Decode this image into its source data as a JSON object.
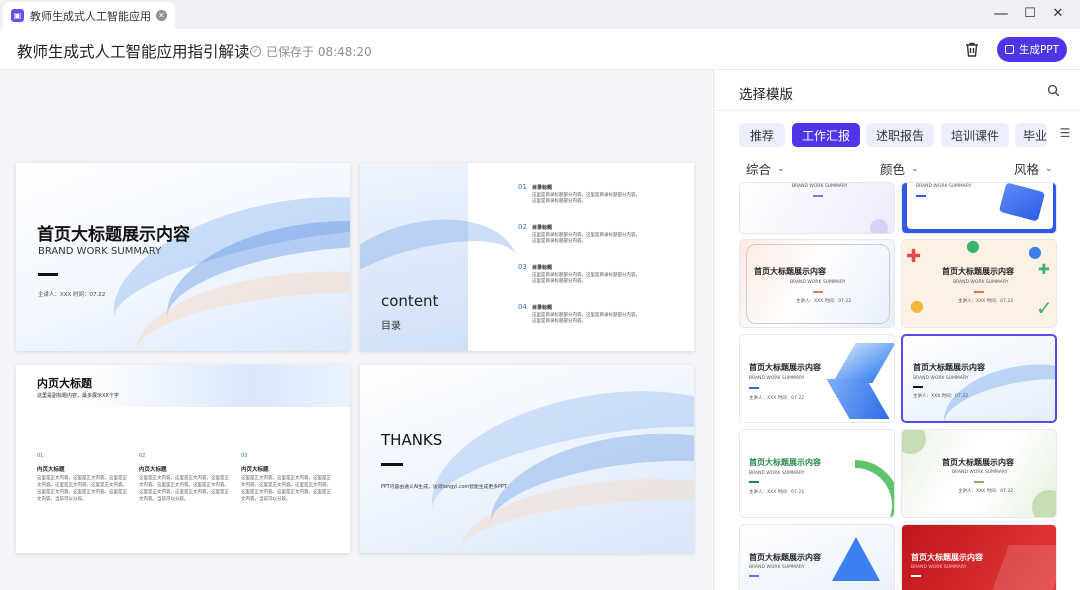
{
  "window": {
    "tab_icon": "ppt-icon",
    "tab_title": "教师生成式人工智能应用指...",
    "controls": [
      "☰",
      "—",
      "☐",
      "✕"
    ]
  },
  "header": {
    "doc_title": "教师生成式人工智能应用指引解读",
    "saved_text": "已保存于 08:48:20",
    "generate_label": "生成PPT",
    "accent": "#4f35e8"
  },
  "slides": {
    "cover": {
      "title": "首页大标题展示内容",
      "subtitle": "BRAND WORK SUMMARY",
      "meta": "主讲人：XXX  时间：07.22"
    },
    "toc": {
      "title": "content",
      "subtitle": "目录",
      "items": [
        {
          "num": "01",
          "head": "目录标题",
          "text": "这里是目录标题部分内容。这里是目录标题部分内容。这里是目录标题部分内容。"
        },
        {
          "num": "02",
          "head": "目录标题",
          "text": "这里是目录标题部分内容。这里是目录标题部分内容。这里是目录标题部分内容。"
        },
        {
          "num": "03",
          "head": "目录标题",
          "text": "这里是目录标题部分内容。这里是目录标题部分内容。这里是目录标题部分内容。"
        },
        {
          "num": "04",
          "head": "目录标题",
          "text": "这里是目录标题部分内容。这里是目录标题部分内容。这里是目录标题部分内容。"
        }
      ]
    },
    "inner": {
      "title": "内页大标题",
      "subtitle": "这里是副标题内容，最多展示XX个字",
      "cols": [
        {
          "num": "01",
          "head": "内页大标题",
          "text": "这里是正文内容。这里是正文内容。这里是正文内容。这里是正文内容。这里是正文内容。这里是正文内容。这里是正文内容。这里是正文内容。当前可以分段。"
        },
        {
          "num": "02",
          "head": "内页大标题",
          "text": "这里是正文内容。这里是正文内容。这里是正文内容。这里是正文内容。这里是正文内容。这里是正文内容。这里是正文内容。这里是正文内容。当前可以分段。"
        },
        {
          "num": "03",
          "head": "内页大标题",
          "text": "这里是正文内容。这里是正文内容。这里是正文内容。这里是正文内容。这里是正文内容。这里是正文内容。这里是正文内容。这里是正文内容。当前可以分段。"
        }
      ]
    },
    "thanks": {
      "title": "THANKS",
      "note": "PPT内容由通义AI生成，访问tongyi.com智能生成更多PPT"
    }
  },
  "panel": {
    "title": "选择模版",
    "tabs": [
      "推荐",
      "工作汇报",
      "述职报告",
      "培训课件",
      "毕业"
    ],
    "active_tab": "工作汇报",
    "filters": [
      "综合",
      "颜色",
      "风格"
    ],
    "template_title": "首页大标题展示内容",
    "template_sub": "BRAND WORK SUMMARY",
    "template_meta": "主讲人：XXX  时间：07.22"
  }
}
